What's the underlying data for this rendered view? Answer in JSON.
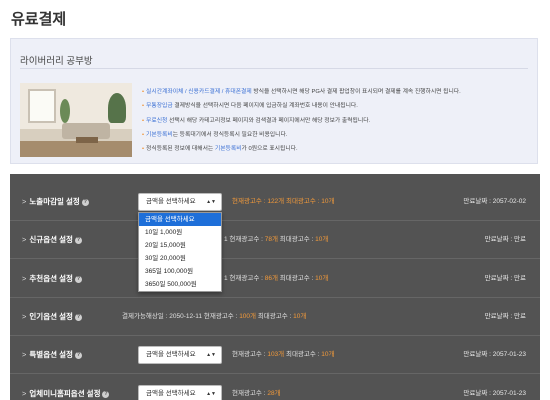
{
  "page_title": "유료결제",
  "info": {
    "title": "라이버러리 공부방",
    "notes": [
      {
        "parts": [
          {
            "t": "실시간계좌이체 / 신용카드결제 / 휴대폰결제",
            "c": "hl"
          },
          {
            "t": " 방식을 선택하시면 해당 PG사 결제 팝업창이 표시되며 결제를 계속 진행하시면 됩니다.",
            "c": ""
          }
        ]
      },
      {
        "parts": [
          {
            "t": "무통장입금",
            "c": "hl"
          },
          {
            "t": " 결제방식을 선택하시면 다음 페이지에 입금하실 계좌번호 내용이 안내됩니다.",
            "c": ""
          }
        ]
      },
      {
        "parts": [
          {
            "t": "무료신청",
            "c": "hl"
          },
          {
            "t": " 선택시 해당 카테고리정보 페이지와 검색결과 페이지에서만 해당 정보가 출력됩니다.",
            "c": ""
          }
        ]
      },
      {
        "parts": [
          {
            "t": "기본등록비",
            "c": "hl"
          },
          {
            "t": "는 등록대기에서 정식등록시 필요한 비용입니다.",
            "c": ""
          }
        ]
      },
      {
        "parts": [
          {
            "t": "정식등록된 정보에 대해서는 ",
            "c": ""
          },
          {
            "t": "기본등록비",
            "c": "hl"
          },
          {
            "t": "가 0원으로 표시됩니다.",
            "c": ""
          }
        ]
      }
    ]
  },
  "rows": [
    {
      "label": "노출마감일 설정",
      "select": "금액을 선택하세요",
      "stats_prefix": "",
      "current_label": "현재광고수 : ",
      "current": "122개",
      "max_label": "최대광고수 : ",
      "max": "10개",
      "expiry": "만료날짜 : 2057-02-02",
      "highlight_current_label": true
    },
    {
      "label": "신규옵션 설정",
      "select": "",
      "stats_prefix": "1",
      "current_label": "현재광고수 : ",
      "current": "78개",
      "max_label": "최대광고수 : ",
      "max": "10개",
      "expiry": "만료날짜 : 만료",
      "highlight_current_label": false
    },
    {
      "label": "추천옵션 설정",
      "select": "",
      "stats_prefix": "1",
      "current_label": "현재광고수 : ",
      "current": "86개",
      "max_label": "최대광고수 : ",
      "max": "10개",
      "expiry": "만료날짜 : 만료",
      "highlight_current_label": false
    },
    {
      "label": "인기옵션 설정",
      "select": "",
      "stats_prefix": "결제가능해상일 : 2050-12-11",
      "current_label": "현재광고수 : ",
      "current": "100개",
      "max_label": "최대광고수 : ",
      "max": "10개",
      "expiry": "만료날짜 : 만료",
      "highlight_current_label": false
    },
    {
      "label": "특별옵션 설정",
      "select": "금액을 선택하세요",
      "stats_prefix": "",
      "current_label": "현재광고수 : ",
      "current": "103개",
      "max_label": "최대광고수 : ",
      "max": "10개",
      "expiry": "만료날짜 : 2057-01-23",
      "highlight_current_label": false
    },
    {
      "label": "업체미니홈피옵션 설정",
      "select": "금액을 선택하세요",
      "stats_prefix": "",
      "current_label": "현재광고수 : ",
      "current": "28개",
      "max_label": "",
      "max": "",
      "expiry": "만료날짜 : 2057-01-23",
      "highlight_current_label": false
    }
  ],
  "dropdown": {
    "options": [
      "금액을 선택하세요",
      "10일 1,000원",
      "20일 15,000원",
      "30일 20,000원",
      "365일 100,000원",
      "3650일 500,000원"
    ],
    "selected_index": 0
  },
  "colors": {
    "accent": "#1e6fd9",
    "panel": "#535353",
    "orange": "#f39a3a",
    "link": "#3a6fd4"
  }
}
